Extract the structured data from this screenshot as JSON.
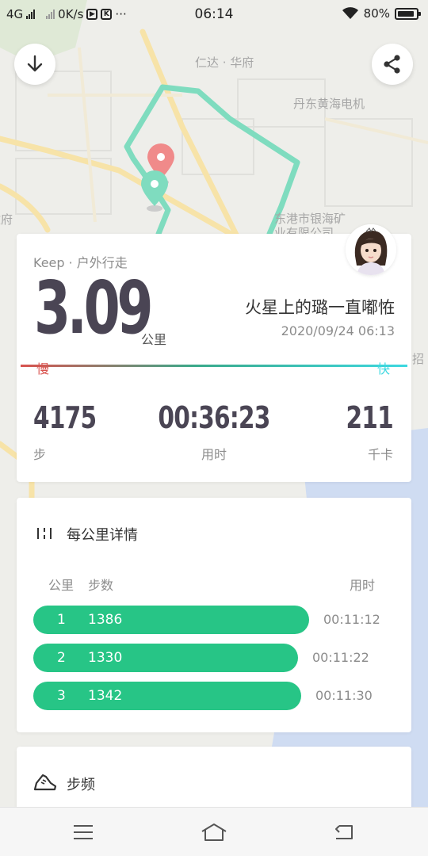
{
  "status_bar": {
    "network": "4G",
    "speed": "0K/s",
    "more": "···",
    "time": "06:14",
    "battery": "80%"
  },
  "map": {
    "labels": {
      "renda": "仁达 · 华府",
      "dandong": "丹东黄海电机",
      "donggang": "东港市银海矿",
      "donggang2": "业有限公司",
      "fu": "政府",
      "zhao": "招"
    },
    "route_color": "#7fdcbf"
  },
  "summary": {
    "source": "Keep · 户外行走",
    "distance": "3.09",
    "distance_unit": "公里",
    "username": "火星上的璐一直嘟恠",
    "datetime": "2020/09/24 06:13",
    "pace_slow": "慢",
    "pace_fast": "快",
    "steps_value": "4175",
    "steps_label": "步",
    "duration_value": "00:36:23",
    "duration_label": "用时",
    "calories_value": "211",
    "calories_label": "千卡"
  },
  "km_detail": {
    "title": "每公里详情",
    "col_km": "公里",
    "col_steps": "步数",
    "col_time": "用时",
    "rows": [
      {
        "km": "1",
        "steps": "1386",
        "time": "00:11:12",
        "fill": 1.0
      },
      {
        "km": "2",
        "steps": "1330",
        "time": "00:11:22",
        "fill": 0.96
      },
      {
        "km": "3",
        "steps": "1342",
        "time": "00:11:30",
        "fill": 0.97
      }
    ]
  },
  "cadence": {
    "title": "步频"
  },
  "colors": {
    "accent_green": "#27c586",
    "slow_red": "#d9534f",
    "fast_cyan": "#3cd8e0",
    "pin_red": "#f08a8a",
    "pin_green": "#7fdcbf"
  },
  "icons": {
    "download": "down-arrow-icon",
    "share": "share-icon",
    "detail": "split-bars-icon",
    "cadence": "shoe-icon",
    "nav_menu": "menu-icon",
    "nav_home": "home-icon",
    "nav_back": "back-icon"
  }
}
